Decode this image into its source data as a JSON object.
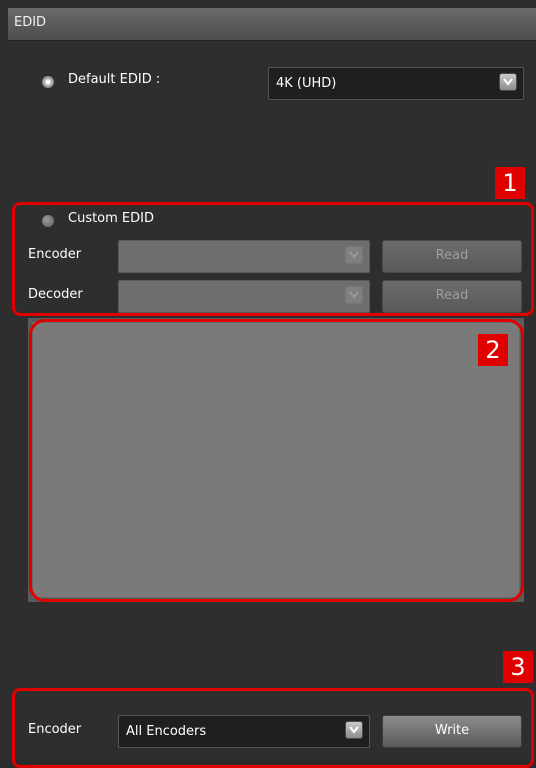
{
  "window": {
    "title": "EDID"
  },
  "default_edid": {
    "label": "Default EDID :",
    "selected": true,
    "value": "4K (UHD)"
  },
  "custom_edid": {
    "label": "Custom EDID",
    "selected": false,
    "encoder_label": "Encoder",
    "encoder_value": "",
    "encoder_read_label": "Read",
    "decoder_label": "Decoder",
    "decoder_value": "",
    "decoder_read_label": "Read"
  },
  "edid_data": {
    "content": ""
  },
  "write_section": {
    "encoder_label": "Encoder",
    "encoder_value": "All Encoders",
    "write_label": "Write"
  },
  "annotations": {
    "box1": "1",
    "box2": "2",
    "box3": "3",
    "color": "#e00000"
  }
}
